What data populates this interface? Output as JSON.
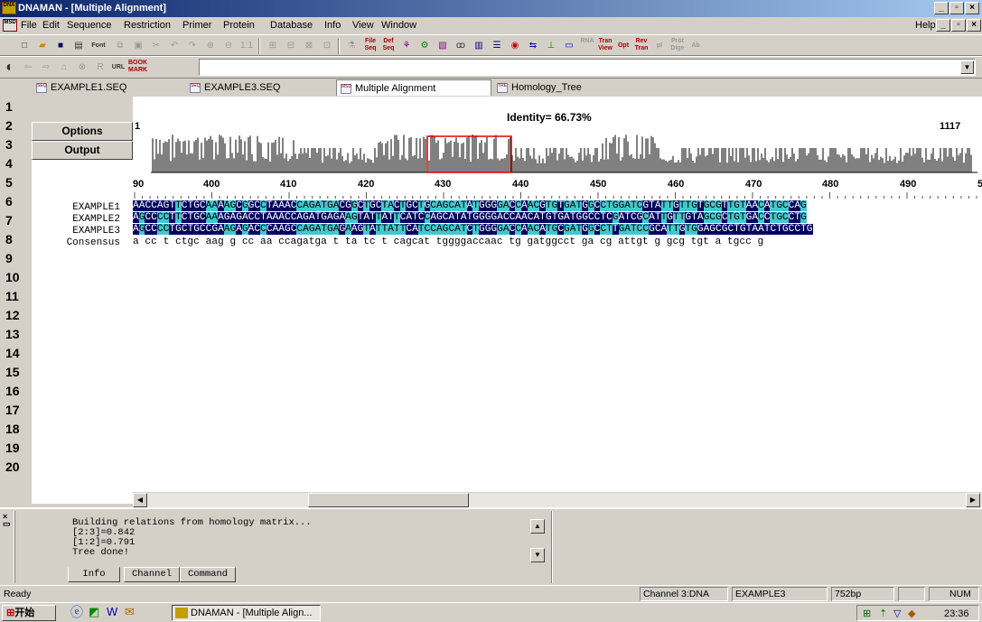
{
  "window": {
    "title": "DNAMAN - [Multiple Alignment]",
    "app_icon": "DNA\nMAN"
  },
  "menu": {
    "items": [
      "File",
      "Edit",
      "Sequence",
      "Restriction",
      "Primer",
      "Protein",
      "Database",
      "Info",
      "View",
      "Window"
    ],
    "help": "Help"
  },
  "toolbar1": {
    "font_label": "Font",
    "ratio_label": "1:1",
    "file_seq": "File\nSeq",
    "def_seq": "Def\nSeq",
    "tran_view": "Tran\nView",
    "opt": "Opt",
    "rev_tran": "Rev\nTran",
    "pi": "pI",
    "prot_dige": "Prot\nDige",
    "ab": "Ab"
  },
  "toolbar2": {
    "r_label": "R",
    "url_label": "URL",
    "bookmark": "BOOK\nMARK",
    "url_value": ""
  },
  "tabs": [
    {
      "label": "EXAMPLE1.SEQ"
    },
    {
      "label": "EXAMPLE3.SEQ"
    },
    {
      "label": "Multiple Alignment"
    },
    {
      "label": "Homology_Tree"
    }
  ],
  "line_numbers": [
    "1",
    "2",
    "3",
    "4",
    "5",
    "6",
    "7",
    "8",
    "9",
    "10",
    "11",
    "12",
    "13",
    "14",
    "15",
    "16",
    "17",
    "18",
    "19",
    "20"
  ],
  "side": {
    "options": "Options",
    "output": "Output"
  },
  "overview": {
    "start": "1",
    "end": "1117",
    "identity": "Identity= 66.73%"
  },
  "ruler": [
    "90",
    "400",
    "410",
    "420",
    "430",
    "440",
    "450",
    "460",
    "470",
    "480",
    "490",
    "50"
  ],
  "sequences": [
    {
      "name": "EXAMPLE1",
      "text": "AACCAGTTCTGCAAAAGCGGCCTAAACCAGATGACGGCTGCTACTGCTGCAGCATATGGGGACCAACGTGTGATGGCCTGGATCGTATTGTTGTGCGTTGTAACATGCCAG"
    },
    {
      "name": "EXAMPLE2",
      "text": "AGCCCCTTCTGCAAAGAGACCTAAACCAGATGAGAAGTATTATTCATCCAGCATATGGGGACCAACATGTGATGGCCTCGATCGCATTGTTGTAGCGCTGTGACCTGCCTG"
    },
    {
      "name": "EXAMPLE3",
      "text": "AGCCCCTGCTGCCGAAGAGACCCAAGCCAGATGAGAAGTATTATTCATCCAGCATCTGGGGACCAACATGCGATGGCCTTGATCCGCATTGTGGAGCGCTGTAATCTGCCTG"
    }
  ],
  "consensus": {
    "name": "Consensus",
    "text": "a cc   t ctgc   aag g cc aa ccagatga      t  ta tc t cagcat tggggaccaac tg gatggcct ga cg attgt g gcg tgt a  tgcc g"
  },
  "log": {
    "lines": [
      "Building relations from homology matrix...",
      "[2:3]=0.842",
      "[1:2]=0.791",
      "Tree done!"
    ]
  },
  "bottom_tabs": [
    "Info",
    "Channel",
    "Command"
  ],
  "status": {
    "ready": "Ready",
    "channel": "Channel 3:DNA",
    "seq": "EXAMPLE3",
    "length": "752bp",
    "num": "NUM"
  },
  "taskbar": {
    "start": "开始",
    "task": "DNAMAN - [Multiple Align...",
    "clock": "23:36"
  },
  "colors": {
    "match_dark": "#000060",
    "match_cyan": "#40c8d0",
    "title_blue": "#0a246a",
    "highlight_red": "#e00000"
  }
}
